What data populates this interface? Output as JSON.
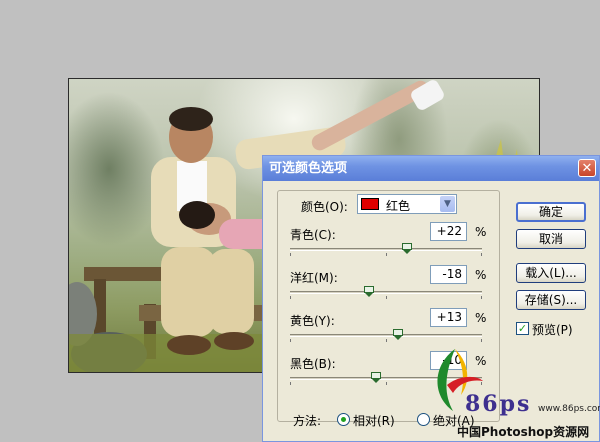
{
  "dialog": {
    "title": "可选颜色选项",
    "close_glyph": "✕",
    "color": {
      "label": "颜色(O):",
      "value": "红色",
      "swatch": "#e00000"
    },
    "sliders": [
      {
        "label": "青色(C):",
        "value": "+22",
        "unit": "%",
        "level_percent": 22
      },
      {
        "label": "洋红(M):",
        "value": "-18",
        "unit": "%",
        "level_percent": -18
      },
      {
        "label": "黄色(Y):",
        "value": "+13",
        "unit": "%",
        "level_percent": 13
      },
      {
        "label": "黑色(B):",
        "value": "-10",
        "unit": "%",
        "level_percent": -10
      }
    ],
    "buttons": {
      "ok": "确定",
      "cancel": "取消",
      "load": "载入(L)...",
      "save": "存储(S)..."
    },
    "preview": {
      "label": "预览(P)",
      "checked": true
    },
    "method": {
      "label": "方法:",
      "relative": "相对(R)",
      "absolute": "绝对(A)",
      "selected": "relative"
    }
  },
  "watermark": {
    "brand": "86ps",
    "url": "www.86ps.com",
    "site_name": "中国Photoshop资源网"
  },
  "colors": {
    "titlebar": "#6f93e3",
    "dialog_bg": "#ece9d8",
    "workspace": "#c0c0c0"
  }
}
